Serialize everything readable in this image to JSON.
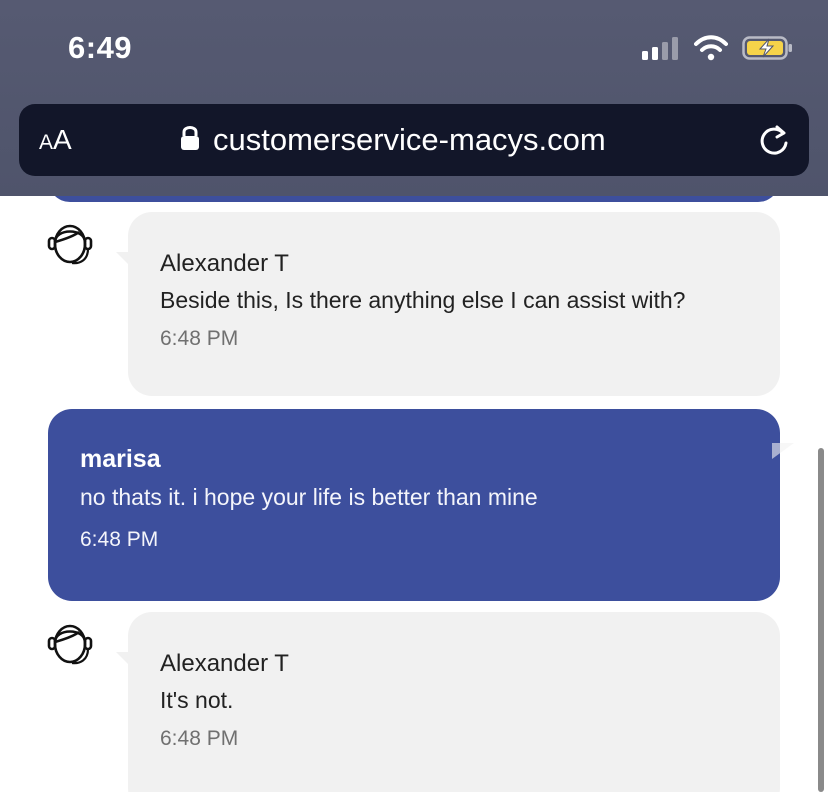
{
  "status_bar": {
    "time": "6:49",
    "icons": [
      "signal-icon",
      "wifi-icon",
      "battery-charging-icon"
    ],
    "battery_color": "#f5d34a"
  },
  "url_bar": {
    "text_size_label": "AA",
    "text_size_small": "A",
    "text_size_large": "A",
    "url": "customerservice-macys.com",
    "icons": [
      "lock-icon",
      "reload-icon"
    ]
  },
  "colors": {
    "user_bubble": "#3d4f9d",
    "agent_bubble": "#f1f1f1",
    "url_bar_bg": "#121629",
    "top_bg": "#535770"
  },
  "messages": [
    {
      "role": "agent",
      "sender": "Alexander T",
      "text": "Beside this, Is there anything else I can assist with?",
      "time": "6:48 PM"
    },
    {
      "role": "user",
      "sender": "marisa",
      "text": "no thats it. i hope your life is better than mine",
      "time": "6:48 PM"
    },
    {
      "role": "agent",
      "sender": "Alexander T",
      "text": "It's not.",
      "time": "6:48 PM"
    }
  ]
}
